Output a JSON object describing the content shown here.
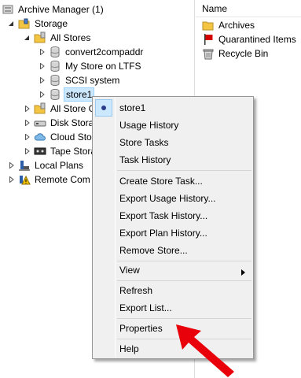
{
  "tree": {
    "root": "Archive Manager (1)",
    "storage": "Storage",
    "all_stores": "All Stores",
    "stores": [
      "convert2compaddr",
      "My Store on LTFS",
      "SCSI system",
      "store1"
    ],
    "all_store_groups": "All Store G",
    "disk_storage": "Disk Stora",
    "cloud_storage": "Cloud Sto",
    "tape_storage": "Tape Stora",
    "local_plans": "Local Plans",
    "remote_computers": "Remote Com"
  },
  "list": {
    "column_name": "Name",
    "items": [
      "Archives",
      "Quarantined Items",
      "Recycle Bin"
    ]
  },
  "context_menu": {
    "store1": "store1",
    "usage_history": "Usage History",
    "store_tasks": "Store Tasks",
    "task_history": "Task History",
    "create_store_task": "Create Store Task...",
    "export_usage_history": "Export Usage History...",
    "export_task_history": "Export Task History...",
    "export_plan_history": "Export Plan History...",
    "remove_store": "Remove Store...",
    "view": "View",
    "refresh": "Refresh",
    "export_list": "Export List...",
    "properties": "Properties",
    "help": "Help"
  },
  "colors": {
    "selection_bg": "#cce8ff",
    "menu_bg": "#f0f0f0",
    "annotation_arrow": "#e8000b"
  }
}
